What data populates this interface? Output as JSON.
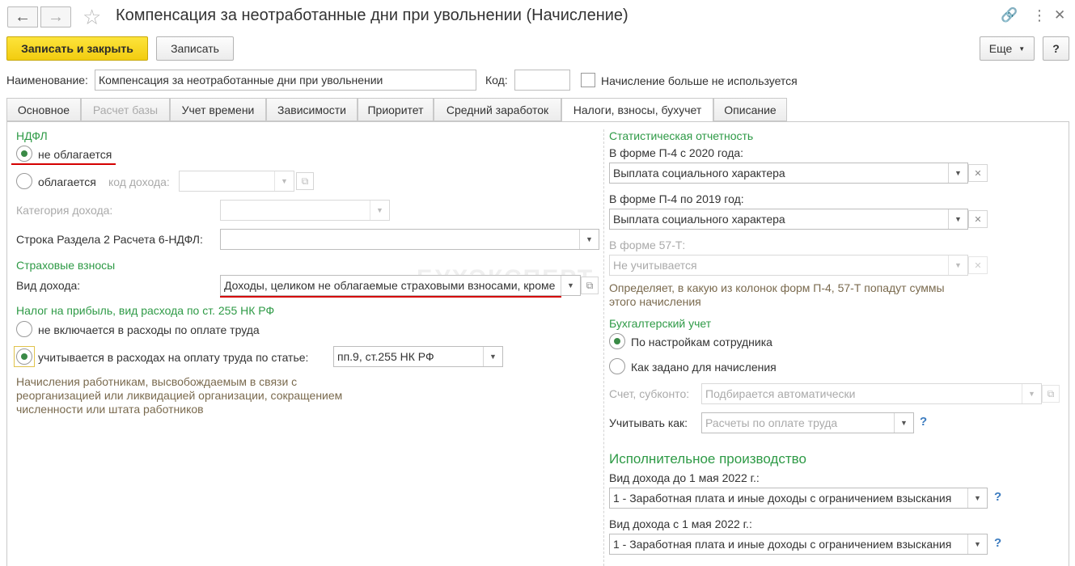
{
  "window": {
    "title": "Компенсация за неотработанные дни при увольнении (Начисление)",
    "back_icon": "arrow-left-icon",
    "forward_icon": "arrow-right-icon"
  },
  "toolbar": {
    "save_close": "Записать и закрыть",
    "save": "Записать",
    "more": "Еще",
    "help": "?"
  },
  "header": {
    "name_label": "Наименование:",
    "name_value": "Компенсация за неотработанные дни при увольнении",
    "code_label": "Код:",
    "code_value": "",
    "not_used_label": "Начисление больше не используется"
  },
  "tabs": [
    {
      "label": "Основное"
    },
    {
      "label": "Расчет базы"
    },
    {
      "label": "Учет времени"
    },
    {
      "label": "Зависимости"
    },
    {
      "label": "Приоритет"
    },
    {
      "label": "Средний заработок"
    },
    {
      "label": "Налоги, взносы, бухучет"
    },
    {
      "label": "Описание"
    }
  ],
  "left": {
    "ndfl_title": "НДФЛ",
    "ndfl_not_taxed": "не облагается",
    "ndfl_taxed": "облагается",
    "income_code_label": "код дохода:",
    "income_category_label": "Категория дохода:",
    "section2_label": "Строка Раздела 2 Расчета 6-НДФЛ:",
    "insurance_title": "Страховые взносы",
    "income_type_label": "Вид дохода:",
    "income_type_value": "Доходы, целиком не облагаемые страховыми взносами, кроме",
    "profit_title": "Налог на прибыль, вид расхода по ст. 255 НК РФ",
    "profit_not_included": "не включается в расходы по оплате труда",
    "profit_included": "учитывается в расходах на оплату труда по статье:",
    "profit_article_value": "пп.9, ст.255 НК РФ",
    "profit_hint": "Начисления работникам, высвобождаемым в связи с реорганизацией или ликвидацией организации, сокращением численности или штата работников"
  },
  "right": {
    "stats_title": "Статистическая отчетность",
    "p4_2020_label": "В форме П-4 с 2020 года:",
    "p4_2020_value": "Выплата социального характера",
    "p4_2019_label": "В форме П-4 по 2019 год:",
    "p4_2019_value": "Выплата социального характера",
    "f57_label": "В форме 57-Т:",
    "f57_value": "Не учитывается",
    "stats_hint": "Определяет, в какую из колонок форм П-4, 57-Т попадут суммы этого начисления",
    "accounting_title": "Бухгалтерский учет",
    "acc_by_employee": "По настройкам сотрудника",
    "acc_as_set": "Как задано для начисления",
    "account_label": "Счет, субконто:",
    "account_value": "Подбирается автоматически",
    "account_as_label": "Учитывать как:",
    "account_as_value": "Расчеты по оплате труда",
    "enforcement_title": "Исполнительное производство",
    "inc_before_label": "Вид дохода до 1 мая 2022 г.:",
    "inc_before_value": "1 - Заработная плата и иные доходы с ограничением взыскания",
    "inc_after_label": "Вид дохода с 1 мая 2022 г.:",
    "inc_after_value": "1 - Заработная плата и иные доходы с ограничением взыскания",
    "help_mark": "?"
  },
  "watermark": "БУХЭКСПЕРТ",
  "colors": {
    "accent_green": "#2e9a46",
    "primary_yellow": "#f7d51d",
    "highlight_red": "#d40000"
  }
}
